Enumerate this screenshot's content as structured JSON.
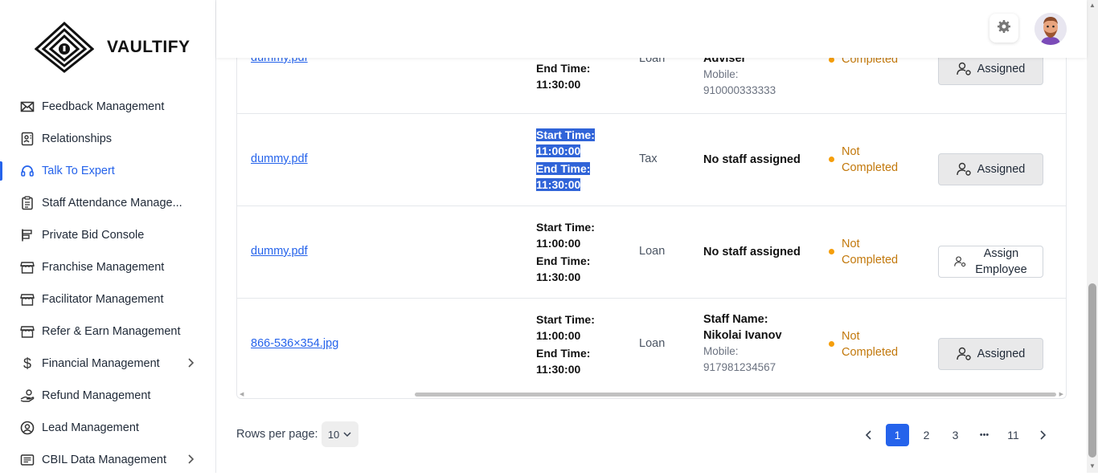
{
  "brand": {
    "name": "VAULTIFY"
  },
  "sidebar": {
    "items": [
      {
        "label": "Feedback Management",
        "icon": "mail-icon"
      },
      {
        "label": "Relationships",
        "icon": "contact-card-icon"
      },
      {
        "label": "Talk To Expert",
        "icon": "headset-icon",
        "active": true
      },
      {
        "label": "Staff Attendance Manage...",
        "icon": "clipboard-icon"
      },
      {
        "label": "Private Bid Console",
        "icon": "bid-icon"
      },
      {
        "label": "Franchise Management",
        "icon": "store-icon"
      },
      {
        "label": "Facilitator Management",
        "icon": "store-icon"
      },
      {
        "label": "Refer & Earn Management",
        "icon": "store-icon"
      },
      {
        "label": "Financial Management",
        "icon": "dollar-icon",
        "expandable": true
      },
      {
        "label": "Refund Management",
        "icon": "refund-hand-icon"
      },
      {
        "label": "Lead Management",
        "icon": "lead-icon"
      },
      {
        "label": "CBIL Data Management",
        "icon": "list-card-icon",
        "expandable": true
      }
    ]
  },
  "table": {
    "rows": [
      {
        "file": "dummy.pdf",
        "start_label": "",
        "start_value": "",
        "end_label": "End Time:",
        "end_value": "11:30:00",
        "type": "Loan",
        "staff_name_line": "Adviser",
        "staff_mobile_label": "Mobile:",
        "staff_mobile": "910000333333",
        "status_line1": "",
        "status_line2": "Completed",
        "action": "Assigned"
      },
      {
        "file": "dummy.pdf",
        "start_label": "Start Time:",
        "start_value": "11:00:00",
        "end_label": "End Time:",
        "end_value": "11:30:00",
        "type": "Tax",
        "staff_text": "No staff assigned",
        "status_line1": "Not",
        "status_line2": "Completed",
        "action": "Assigned"
      },
      {
        "file": "dummy.pdf",
        "start_label": "Start Time:",
        "start_value": "11:00:00",
        "end_label": "End Time:",
        "end_value": "11:30:00",
        "type": "Loan",
        "staff_text": "No staff assigned",
        "status_line1": "Not",
        "status_line2": "Completed",
        "action_line1": "Assign",
        "action_line2": "Employee"
      },
      {
        "file": "866-536×354.jpg",
        "start_label": "Start Time:",
        "start_value": "11:00:00",
        "end_label": "End Time:",
        "end_value": "11:30:00",
        "type": "Loan",
        "staff_name_label": "Staff Name:",
        "staff_name": "Nikolai Ivanov",
        "staff_mobile_label": "Mobile:",
        "staff_mobile": "917981234567",
        "status_line1": "Not",
        "status_line2": "Completed",
        "action": "Assigned"
      }
    ]
  },
  "pagination": {
    "rows_per_page_label": "Rows per page:",
    "rows_per_page_value": "10",
    "pages": [
      "1",
      "2",
      "3",
      "•••",
      "11"
    ],
    "current": "1"
  },
  "colors": {
    "accent": "#2563eb",
    "status": "#c2780b",
    "status_dot": "#f59e0b"
  }
}
